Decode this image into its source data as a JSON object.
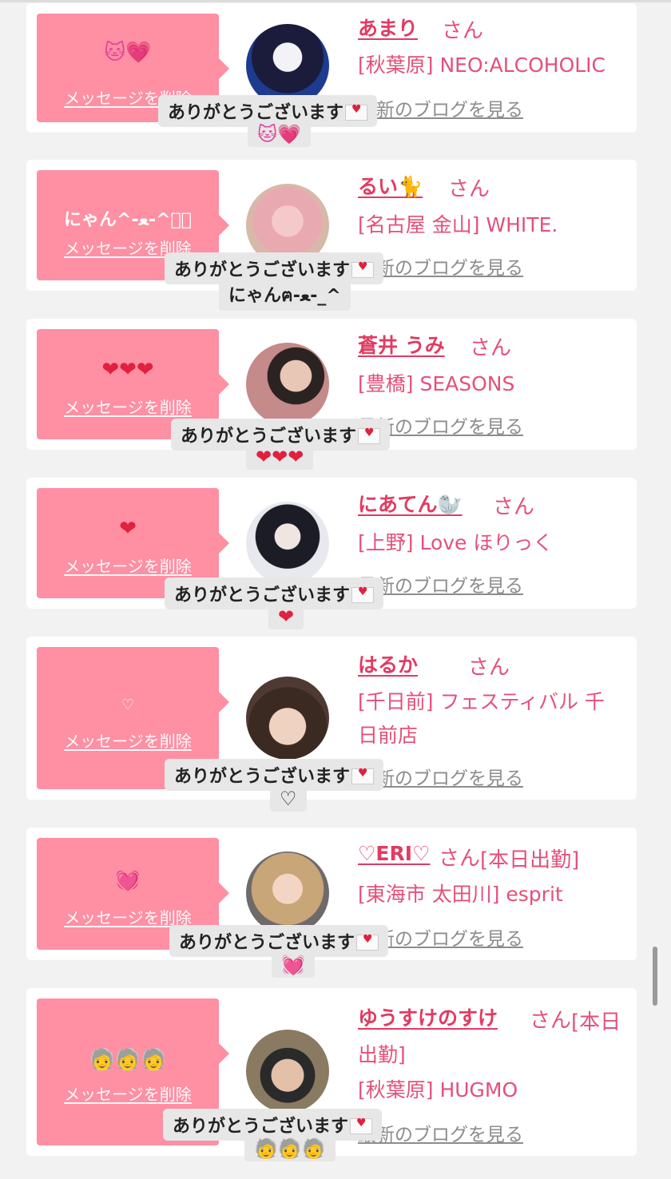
{
  "san_label": "さん",
  "delete_label": "メッセージを削除",
  "blog_label": "最新のブログを見る",
  "thanks_label": "ありがとうございます",
  "accent_color": "#ff8fa3",
  "name_color": "#e23a62",
  "entries": [
    {
      "name": "あまり",
      "extra": "",
      "shop": "[秋葉原] NEO:ALCOHOLIC",
      "shop2": "",
      "message": "🐱💗",
      "reply": "🐱💗"
    },
    {
      "name": "るい🐈",
      "extra": "",
      "shop": "[名古屋 金山] WHITE.",
      "shop2": "",
      "message": "にゃん^-ﻌ-^ฅ゙",
      "reply": "にゃんฅ-ﻌ-_^"
    },
    {
      "name": "蒼井 うみ",
      "extra": "",
      "shop": "[豊橋] SEASONS",
      "shop2": "",
      "message": "❤❤❤",
      "reply": "❤❤❤"
    },
    {
      "name": "にあてん🦭",
      "extra": "",
      "shop": "[上野] Love ほりっく",
      "shop2": "",
      "message": "❤",
      "reply": "❤"
    },
    {
      "name": "はるか",
      "extra": "",
      "shop": "[千日前] フェスティバル 千",
      "shop2": "日前店",
      "message": "♡",
      "reply": "♡"
    },
    {
      "name": "♡ERI♡",
      "extra": "[本日出勤]",
      "shop": "[東海市 太田川] esprit",
      "shop2": "",
      "message": "💓",
      "reply": "💓"
    },
    {
      "name": "ゆうすけのすけ",
      "extra": "[本日",
      "shop": "出勤]",
      "shop2": "[秋葉原] HUGMO",
      "message": "🧓🧓🧓",
      "reply": "🧓🧓🧓"
    }
  ]
}
